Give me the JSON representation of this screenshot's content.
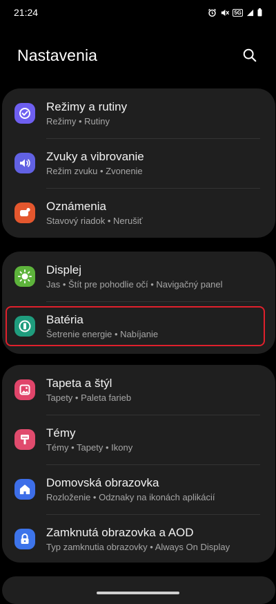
{
  "status_bar": {
    "time": "21:24",
    "network_badge": "5G"
  },
  "header": {
    "title": "Nastavenia"
  },
  "groups": [
    {
      "items": [
        {
          "title": "Režimy a rutiny",
          "subtitle": "Režimy  •  Rutiny",
          "icon": "modes-routines-icon",
          "color": "#6e5ff0"
        },
        {
          "title": "Zvuky a vibrovanie",
          "subtitle": "Režim zvuku  •  Zvonenie",
          "icon": "sound-icon",
          "color": "#6161e3"
        },
        {
          "title": "Oznámenia",
          "subtitle": "Stavový riadok  •  Nerušiť",
          "icon": "notifications-icon",
          "color": "#e4572e"
        }
      ]
    },
    {
      "items": [
        {
          "title": "Displej",
          "subtitle": "Jas  •  Štít pre pohodlie očí  •  Navigačný panel",
          "icon": "display-icon",
          "color": "#5db33b"
        },
        {
          "title": "Batéria",
          "subtitle": "Šetrenie energie  •  Nabíjanie",
          "icon": "battery-icon",
          "color": "#1f9c7d"
        }
      ]
    },
    {
      "items": [
        {
          "title": "Tapeta a štýl",
          "subtitle": "Tapety  •  Paleta farieb",
          "icon": "wallpaper-icon",
          "color": "#e0456a"
        },
        {
          "title": "Témy",
          "subtitle": "Témy  •  Tapety  •  Ikony",
          "icon": "themes-icon",
          "color": "#e04b6d"
        },
        {
          "title": "Domovská obrazovka",
          "subtitle": "Rozloženie  •  Odznaky na ikonách aplikácií",
          "icon": "home-screen-icon",
          "color": "#3d6ee8"
        },
        {
          "title": "Zamknutá obrazovka a AOD",
          "subtitle": "Typ zamknutia obrazovky  •  Always On Display",
          "icon": "lock-icon",
          "color": "#3d74ea"
        }
      ]
    }
  ]
}
